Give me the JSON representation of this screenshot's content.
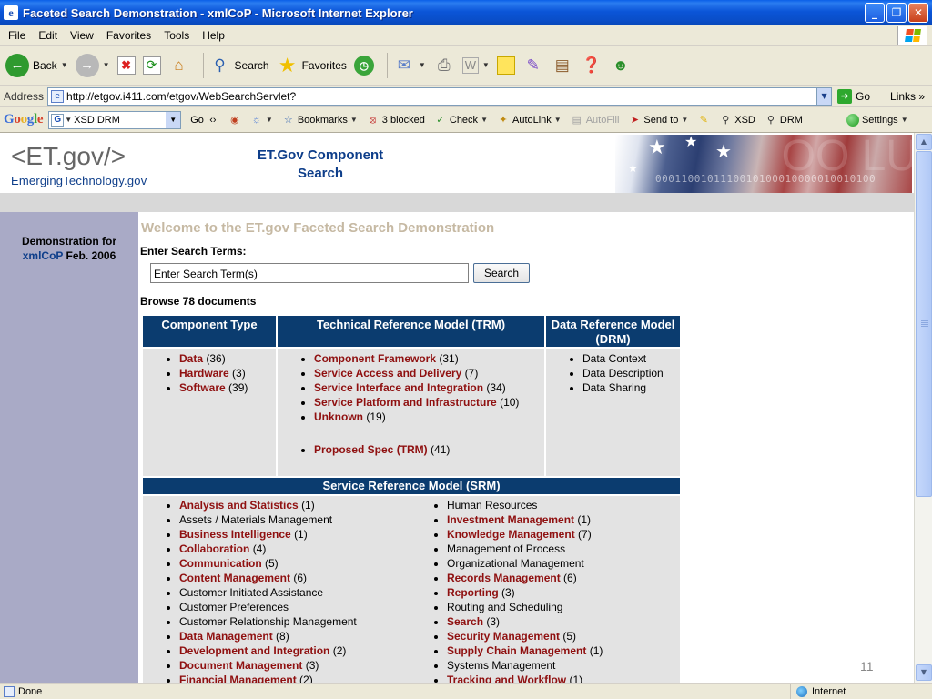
{
  "window": {
    "title": "Faceted Search Demonstration - xmlCoP - Microsoft Internet Explorer",
    "controls": [
      "_",
      "❐",
      "✕"
    ]
  },
  "menubar": {
    "items": [
      "File",
      "Edit",
      "View",
      "Favorites",
      "Tools",
      "Help"
    ]
  },
  "toolbar": {
    "back_label": "Back",
    "search_label": "Search",
    "favorites_label": "Favorites"
  },
  "address": {
    "label": "Address",
    "url": "http://etgov.i411.com/etgov/WebSearchServlet?",
    "go_label": "Go",
    "links_label": "Links"
  },
  "google_toolbar": {
    "logo": "Google",
    "search_value": "XSD DRM",
    "go_label": "Go",
    "bookmarks_label": "Bookmarks",
    "blocked_label": "3 blocked",
    "check_label": "Check",
    "autolink_label": "AutoLink",
    "autofill_label": "AutoFill",
    "sendto_label": "Send to",
    "xsd_label": "XSD",
    "drm_label": "DRM",
    "settings_label": "Settings"
  },
  "page": {
    "logo_main": "<ET.gov/>",
    "logo_sub": "EmergingTechnology.gov",
    "component_title": "ET.Gov Component Search",
    "banner_binary": "0001100101110010100010000010010100",
    "banner_letters": "OO LU",
    "demo_prefix": "Demonstration for",
    "demo_highlight": "xmlCoP",
    "demo_suffix": "Feb. 2006",
    "welcome": "Welcome to the ET.gov Faceted Search Demonstration",
    "enter_label": "Enter Search Terms:",
    "search_placeholder": "Enter Search Term(s)",
    "search_button": "Search",
    "browse_text": "Browse 78 documents",
    "slide_number": "11"
  },
  "facets": {
    "component_type": {
      "header": "Component Type",
      "items": [
        {
          "label": "Data",
          "count": "(36)",
          "link": true
        },
        {
          "label": "Hardware",
          "count": "(3)",
          "link": true
        },
        {
          "label": "Software",
          "count": "(39)",
          "link": true
        }
      ]
    },
    "trm": {
      "header": "Technical Reference Model (TRM)",
      "items": [
        {
          "label": "Component Framework",
          "count": "(31)",
          "link": true
        },
        {
          "label": "Service Access and Delivery",
          "count": "(7)",
          "link": true
        },
        {
          "label": "Service Interface and Integration",
          "count": "(34)",
          "link": true
        },
        {
          "label": "Service Platform and Infrastructure",
          "count": "(10)",
          "link": true
        },
        {
          "label": "Unknown",
          "count": "(19)",
          "link": true
        }
      ],
      "extra": {
        "label": "Proposed Spec (TRM)",
        "count": "(41)",
        "link": true
      }
    },
    "drm": {
      "header": "Data Reference Model (DRM)",
      "items": [
        {
          "label": "Data Context",
          "count": "",
          "link": false
        },
        {
          "label": "Data Description",
          "count": "",
          "link": false
        },
        {
          "label": "Data Sharing",
          "count": "",
          "link": false
        }
      ]
    },
    "srm": {
      "header": "Service Reference Model (SRM)",
      "col1": [
        {
          "label": "Analysis and Statistics",
          "count": "(1)",
          "link": true
        },
        {
          "label": "Assets / Materials Management",
          "count": "",
          "link": false
        },
        {
          "label": "Business Intelligence",
          "count": "(1)",
          "link": true
        },
        {
          "label": "Collaboration",
          "count": "(4)",
          "link": true
        },
        {
          "label": "Communication",
          "count": "(5)",
          "link": true
        },
        {
          "label": "Content Management",
          "count": "(6)",
          "link": true
        },
        {
          "label": "Customer Initiated Assistance",
          "count": "",
          "link": false
        },
        {
          "label": "Customer Preferences",
          "count": "",
          "link": false
        },
        {
          "label": "Customer Relationship Management",
          "count": "",
          "link": false
        },
        {
          "label": "Data Management",
          "count": "(8)",
          "link": true
        },
        {
          "label": "Development and Integration",
          "count": "(2)",
          "link": true
        },
        {
          "label": "Document Management",
          "count": "(3)",
          "link": true
        },
        {
          "label": "Financial Management",
          "count": "(2)",
          "link": true
        }
      ],
      "col2": [
        {
          "label": "Human Resources",
          "count": "",
          "link": false
        },
        {
          "label": "Investment Management",
          "count": "(1)",
          "link": true
        },
        {
          "label": "Knowledge Management",
          "count": "(7)",
          "link": true
        },
        {
          "label": "Management of Process",
          "count": "",
          "link": false
        },
        {
          "label": "Organizational Management",
          "count": "",
          "link": false
        },
        {
          "label": "Records Management",
          "count": "(6)",
          "link": true
        },
        {
          "label": "Reporting",
          "count": "(3)",
          "link": true
        },
        {
          "label": "Routing and Scheduling",
          "count": "",
          "link": false
        },
        {
          "label": "Search",
          "count": "(3)",
          "link": true
        },
        {
          "label": "Security Management",
          "count": "(5)",
          "link": true
        },
        {
          "label": "Supply Chain Management",
          "count": "(1)",
          "link": true
        },
        {
          "label": "Systems Management",
          "count": "",
          "link": false
        },
        {
          "label": "Tracking and Workflow",
          "count": "(1)",
          "link": true
        }
      ]
    }
  },
  "statusbar": {
    "status_text": "Done",
    "zone_text": "Internet"
  },
  "colors": {
    "facet_header_bg": "#0b3c6f",
    "facet_link": "#8f1010",
    "left_panel": "#a9aac6",
    "welcome_text": "#c6b9a3"
  }
}
